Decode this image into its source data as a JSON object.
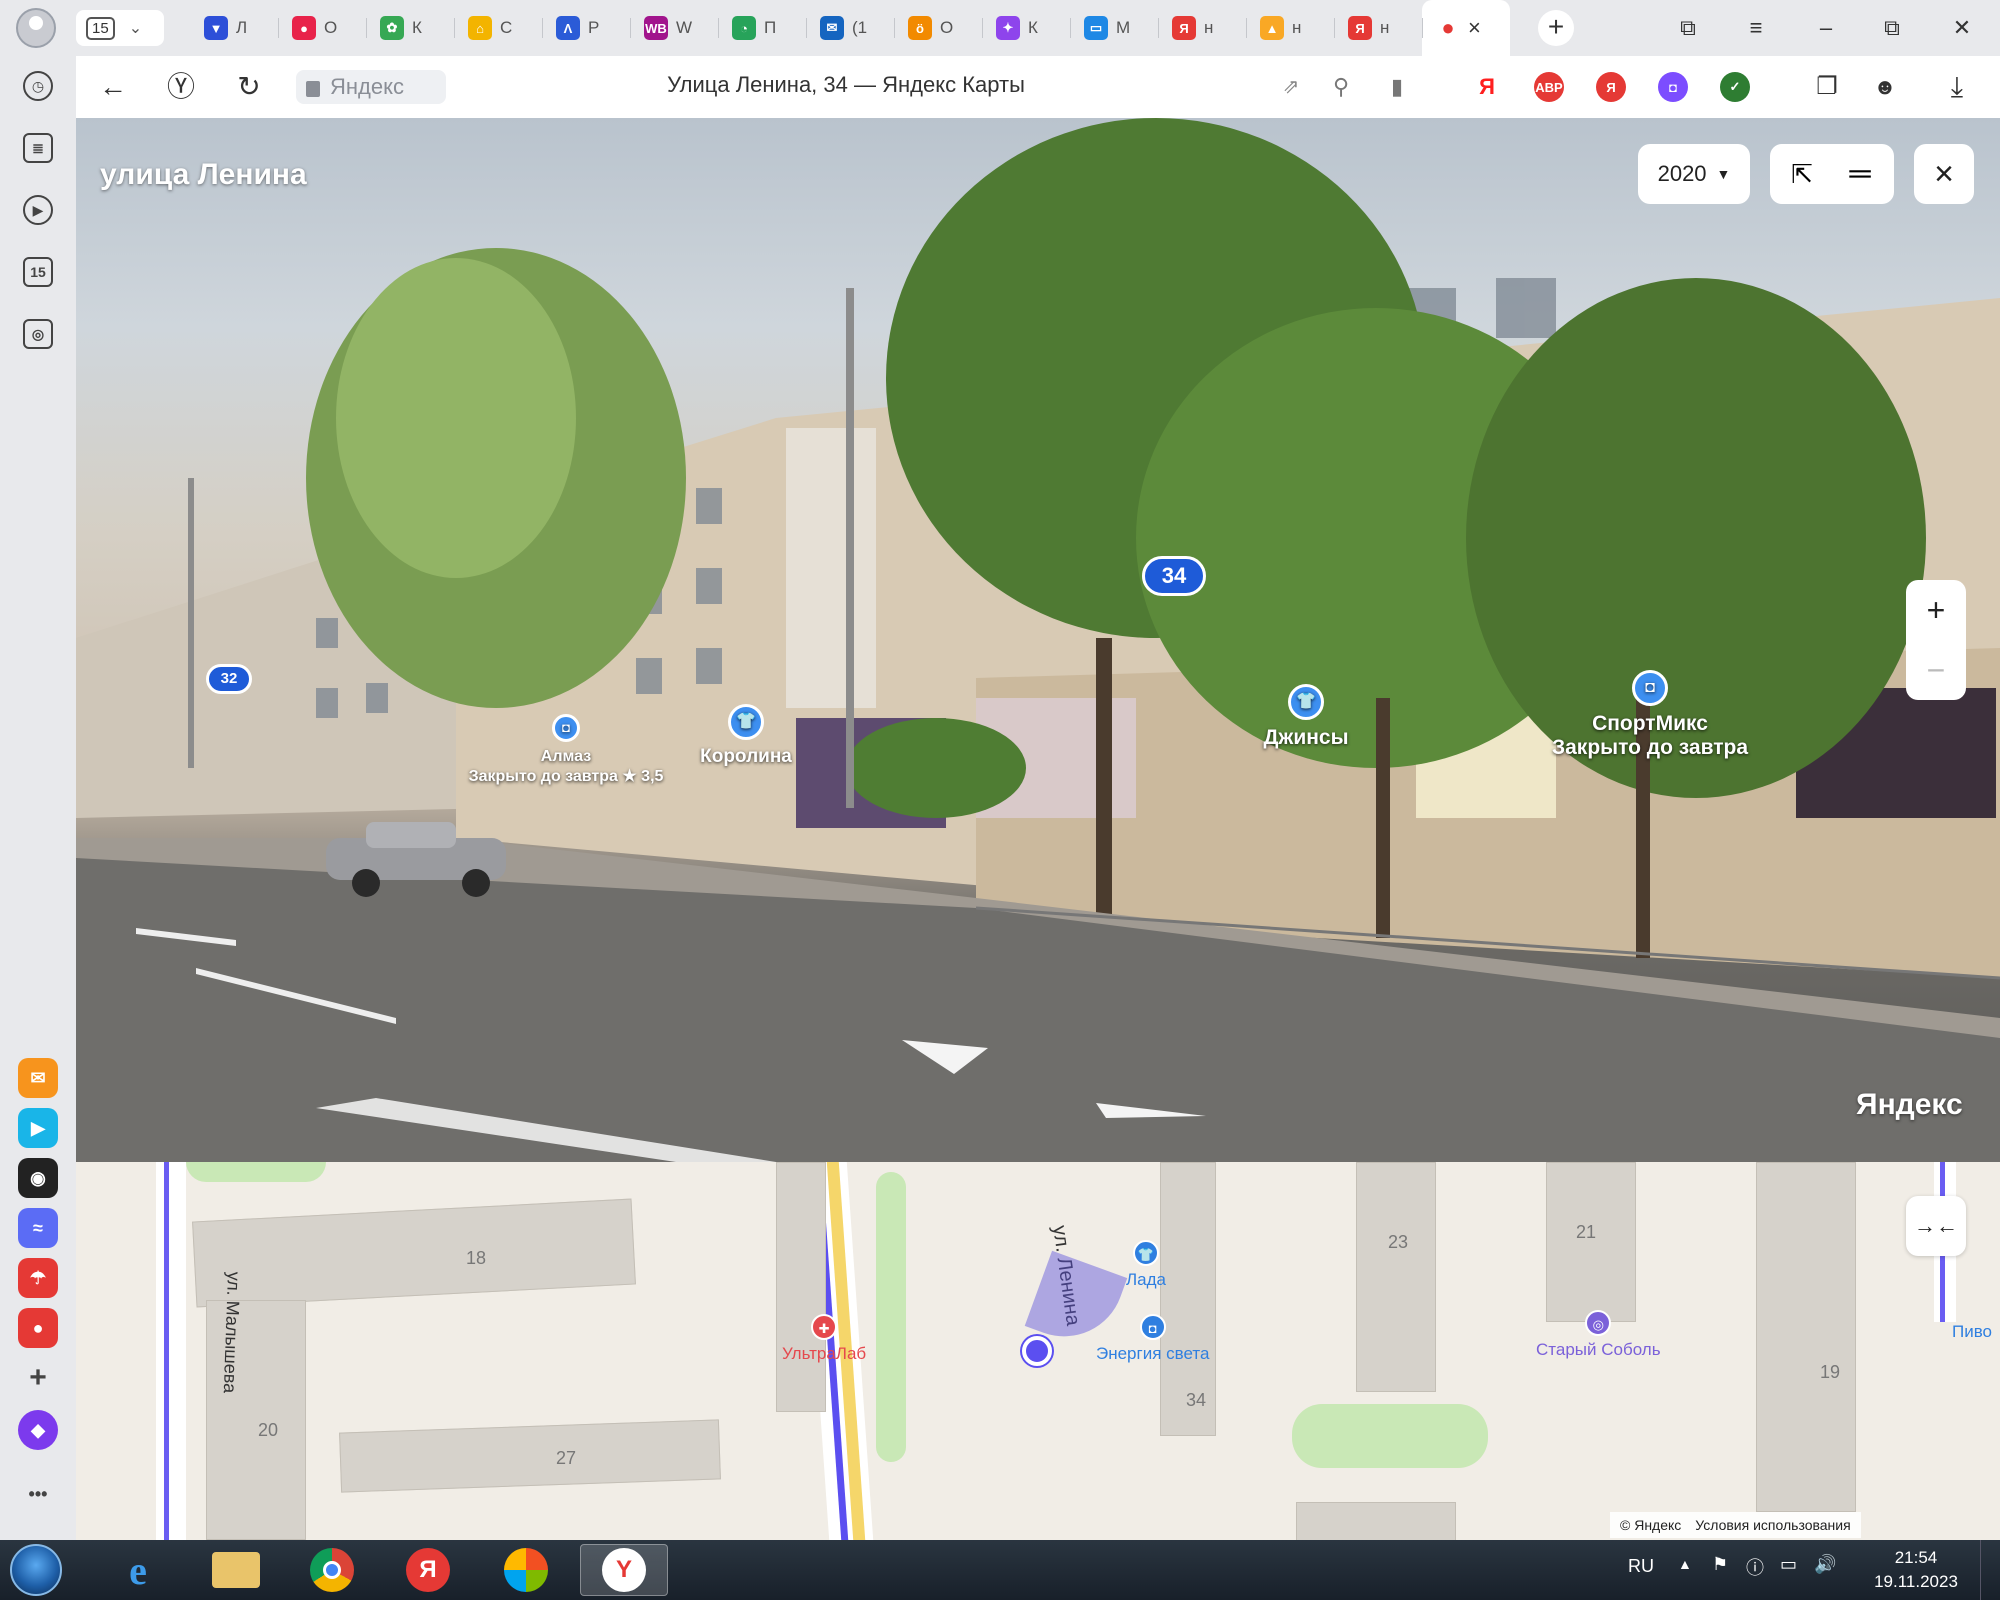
{
  "browser": {
    "tab_counter": "15",
    "tabs": [
      {
        "title": "Л",
        "color": "#2d4fd8",
        "glyph": "▼"
      },
      {
        "title": "О",
        "color": "#e8234a",
        "glyph": "●"
      },
      {
        "title": "К",
        "color": "#36a854",
        "glyph": "✿"
      },
      {
        "title": "С",
        "color": "#f3b400",
        "glyph": "⌂"
      },
      {
        "title": "Р",
        "color": "#2b5bd7",
        "glyph": "Λ"
      },
      {
        "title": "W",
        "color": "#a1148c",
        "glyph": "WB"
      },
      {
        "title": "П",
        "color": "#27a35a",
        "glyph": "◔"
      },
      {
        "title": "(1",
        "color": "#1565c0",
        "glyph": "✉"
      },
      {
        "title": "О",
        "color": "#f28a00",
        "glyph": "ö"
      },
      {
        "title": "К",
        "color": "#8e44ec",
        "glyph": "✦"
      },
      {
        "title": "М",
        "color": "#1e88e5",
        "glyph": "▭"
      },
      {
        "title": "н",
        "color": "#e53935",
        "glyph": "Я"
      },
      {
        "title": "н",
        "color": "#f9a825",
        "glyph": "▲"
      },
      {
        "title": "н",
        "color": "#e53935",
        "glyph": "Я"
      }
    ],
    "active_tab_close": "×",
    "new_tab": "+",
    "address_domain": "Яндекс",
    "page_title": "Улица Ленина, 34 — Яндекс Карты",
    "extensions": [
      {
        "label": "Я",
        "color": "#ff1f1f"
      },
      {
        "label": "ABP",
        "color": "#e53935"
      },
      {
        "label": "Я",
        "color": "#e53935"
      },
      {
        "label": "◘",
        "color": "#7c4dff"
      },
      {
        "label": "✓",
        "color": "#2e7d32"
      }
    ]
  },
  "sidebar": {
    "apps": [
      {
        "name": "mail",
        "color": "#f7941d",
        "glyph": "✉"
      },
      {
        "name": "messenger",
        "color": "#19b5e8",
        "glyph": "▶"
      },
      {
        "name": "alice-app",
        "color": "#222222",
        "glyph": "◉"
      },
      {
        "name": "fb-messenger",
        "color": "#5b6cf5",
        "glyph": "≈"
      },
      {
        "name": "weather",
        "color": "#e53935",
        "glyph": "☂"
      },
      {
        "name": "maps",
        "color": "#e53935",
        "glyph": "●"
      },
      {
        "name": "add",
        "color": "#e8e9ec",
        "glyph": "+"
      }
    ],
    "calendar_day": "15",
    "more": "•••"
  },
  "panorama": {
    "street_name": "улица Ленина",
    "year": "2020",
    "house_numbers": [
      "34",
      "32"
    ],
    "pois": [
      {
        "name": "Алмаз",
        "sub": "Закрыто до завтра ★ 3,5"
      },
      {
        "name": "Королина",
        "sub": ""
      },
      {
        "name": "Джинсы",
        "sub": ""
      },
      {
        "name": "СпортМикс",
        "sub": "Закрыто до завтра"
      }
    ],
    "zoom_in": "+",
    "zoom_out": "−",
    "watermark": "Яндекс"
  },
  "minimap": {
    "streets": [
      "ул. Малышева",
      "ул. Ленина"
    ],
    "house_numbers": [
      "18",
      "20",
      "27",
      "23",
      "21",
      "34",
      "19"
    ],
    "pois": [
      {
        "name": "УльтраЛаб",
        "color": "#e5484d"
      },
      {
        "name": "Лада",
        "color": "#2f7fe0"
      },
      {
        "name": "Энергия света",
        "color": "#2f7fe0"
      },
      {
        "name": "Старый Соболь",
        "color": "#7b61d9"
      },
      {
        "name": "Пиво",
        "color": "#2f7fe0"
      }
    ],
    "collapse": "→←",
    "copyright": "© Яндекс",
    "terms": "Условия использования"
  },
  "taskbar": {
    "language": "RU",
    "time": "21:54",
    "date": "19.11.2023"
  }
}
